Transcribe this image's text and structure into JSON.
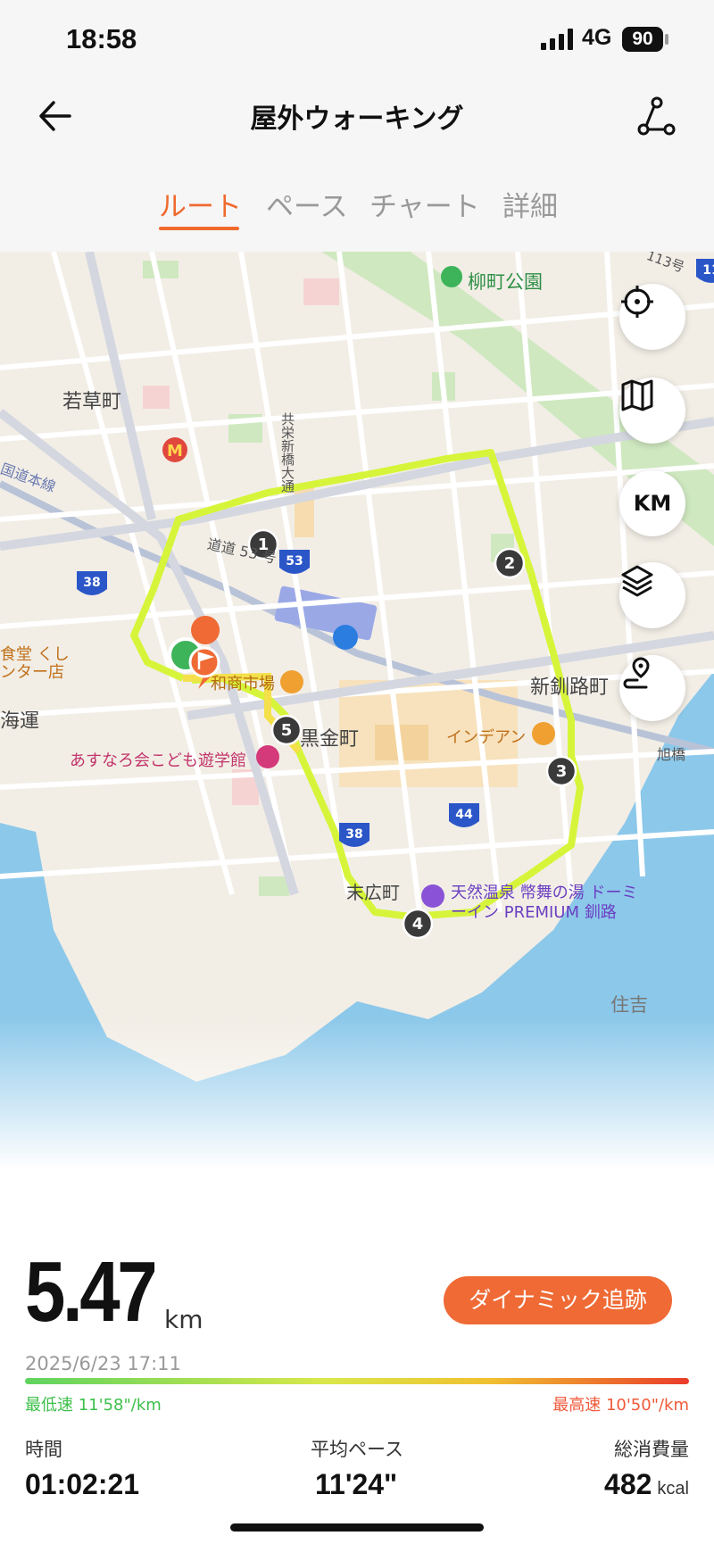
{
  "status_bar": {
    "time": "18:58",
    "network": "4G",
    "battery": "90"
  },
  "header": {
    "title": "屋外ウォーキング"
  },
  "tabs": [
    {
      "label": "ルート",
      "active": true
    },
    {
      "label": "ペース",
      "active": false
    },
    {
      "label": "チャート",
      "active": false
    },
    {
      "label": "詳細",
      "active": false
    }
  ],
  "map": {
    "labels": {
      "park": "柳町公園",
      "wakakusa": "若草町",
      "street": "共栄新橋大通",
      "doudou": "道道 53 号",
      "shinkushiro": "新釧路町",
      "kurokane": "黒金町",
      "market": "和商市場",
      "kids": "あすなろ会こども遊学館",
      "indian": "インデアン",
      "onsen": "天然温泉 幣舞の湯 ドーミーイン PREMIUM 釧路",
      "suehiro": "末広町",
      "sumiyoshi": "住吉",
      "asahi": "旭橋",
      "kaiun": "海運",
      "shokudo": "食堂 くし ンター店",
      "nemuro": "国道本線",
      "road113": "113号",
      "shield38a": "38",
      "shield53": "53",
      "shield44": "44",
      "shield38b": "38",
      "shield11": "11"
    },
    "splits": [
      "1",
      "2",
      "3",
      "4",
      "5"
    ],
    "buttons": [
      {
        "name": "locate",
        "icon": "crosshair-icon"
      },
      {
        "name": "map-style",
        "icon": "map-icon"
      },
      {
        "name": "unit",
        "label": "KM"
      },
      {
        "name": "layers",
        "icon": "layers-icon"
      },
      {
        "name": "route-point",
        "icon": "route-pin-icon"
      }
    ]
  },
  "summary": {
    "distance": "5.47",
    "distance_unit": "km",
    "dynamic_button": "ダイナミック追跡",
    "datetime": "2025/6/23 17:11",
    "min_pace": "最低速 11'58\"/km",
    "max_pace": "最高速 10'50\"/km"
  },
  "stats": [
    {
      "label": "時間",
      "value": "01:02:21"
    },
    {
      "label": "平均ペース",
      "value": "11'24\""
    },
    {
      "label": "総消費量",
      "value": "482",
      "unit": "kcal"
    }
  ],
  "colors": {
    "accent": "#ef6a2f",
    "route": "#d6f53a",
    "route_alt": "#f4e04a",
    "water": "#8cc8ea"
  }
}
